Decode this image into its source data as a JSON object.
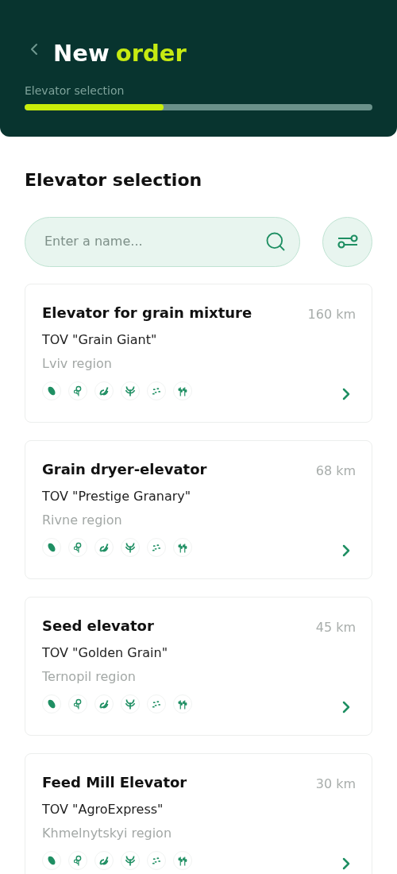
{
  "header": {
    "title_start": "New",
    "title_accent": "order",
    "progress": {
      "label": "Elevator selection",
      "level": 0.4
    }
  },
  "section_title": "Elevator selection",
  "search": {
    "placeholder": "Enter a name..."
  },
  "elevators": [
    {
      "name": "Elevator for grain mixture",
      "distance": "160 km",
      "company": "TOV \"Grain Giant\"",
      "region": "Lviv region"
    },
    {
      "name": "Grain dryer-elevator",
      "distance": "68 km",
      "company": "TOV \"Prestige Granary\"",
      "region": "Rivne region"
    },
    {
      "name": "Seed elevator",
      "distance": "45 km",
      "company": "TOV \"Golden Grain\"",
      "region": "Ternopil region"
    },
    {
      "name": "Feed Mill Elevator",
      "distance": "30 km",
      "company": "TOV \"AgroExpress\"",
      "region": "Khmelnytskyi region"
    }
  ]
}
